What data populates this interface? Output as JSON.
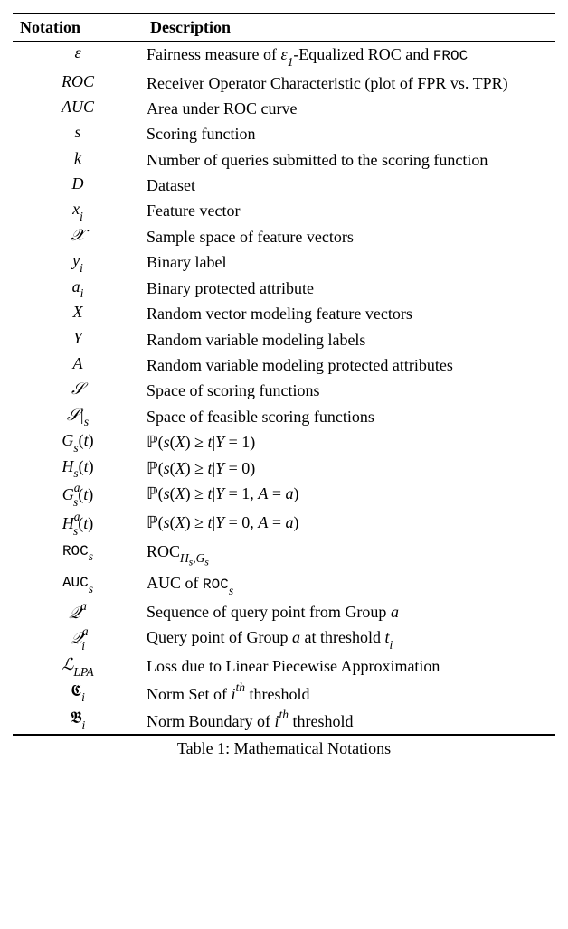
{
  "header": {
    "notation": "Notation",
    "description": "Description"
  },
  "rows": [
    {
      "notation_html": "<span>ε</span>",
      "description_html": "Fairness measure of <i>ε</i><span class='ss'>1</span>-Equalized ROC and <span class='tt'>FROC</span>"
    },
    {
      "notation_html": "<span>ROC</span>",
      "description_html": "Receiver Operator Characteristic (plot of FPR vs. TPR)"
    },
    {
      "notation_html": "<span>AUC</span>",
      "description_html": "Area under ROC curve"
    },
    {
      "notation_html": "<span>s</span>",
      "description_html": "Scoring function"
    },
    {
      "notation_html": "<span>k</span>",
      "description_html": "Number of queries submitted to the scoring function"
    },
    {
      "notation_html": "<span>D</span>",
      "description_html": "Dataset"
    },
    {
      "notation_html": "<span>x<span class='ss'>i</span></span>",
      "description_html": "Feature vector"
    },
    {
      "notation_html": "<span class='cal'>𝒳</span>",
      "description_html": "Sample space of feature vectors"
    },
    {
      "notation_html": "<span>y<span class='ss'>i</span></span>",
      "description_html": "Binary label"
    },
    {
      "notation_html": "<span>a<span class='ss'>i</span></span>",
      "description_html": "Binary protected attribute"
    },
    {
      "notation_html": "<span>X</span>",
      "description_html": "Random vector modeling feature vectors"
    },
    {
      "notation_html": "<span>Y</span>",
      "description_html": "Random variable modeling labels"
    },
    {
      "notation_html": "<span>A</span>",
      "description_html": "Random variable modeling protected attributes"
    },
    {
      "notation_html": "<span class='cal'>𝒮</span>",
      "description_html": "Space of scoring functions"
    },
    {
      "notation_html": "<span class='cal'>𝒮</span>|<span class='ss'>s</span>",
      "description_html": "Space of feasible scoring functions"
    },
    {
      "notation_html": "<span>G<span class='ss'>s</span></span><span class='up'>(</span>t<span class='up'>)</span>",
      "description_html": "<span class='bb'>ℙ</span>(<i>s</i>(<i>X</i>) ≥ <i>t</i>|<i>Y</i> = 1)"
    },
    {
      "notation_html": "<span>H<span class='ss'>s</span></span><span class='up'>(</span>t<span class='up'>)</span>",
      "description_html": "<span class='bb'>ℙ</span>(<i>s</i>(<i>X</i>) ≥ <i>t</i>|<i>Y</i> = 0)"
    },
    {
      "notation_html": "<span>G<span class='sp'>a</span><span class='ss' style='margin-left:-0.55em'>s</span></span><span class='up'>(</span>t<span class='up'>)</span>",
      "description_html": "<span class='bb'>ℙ</span>(<i>s</i>(<i>X</i>) ≥ <i>t</i>|<i>Y</i> = 1, <i>A</i> = <i>a</i>)"
    },
    {
      "notation_html": "<span>H<span class='sp'>a</span><span class='ss' style='margin-left:-0.55em'>s</span></span><span class='up'>(</span>t<span class='up'>)</span>",
      "description_html": "<span class='bb'>ℙ</span>(<i>s</i>(<i>X</i>) ≥ <i>t</i>|<i>Y</i> = 0, <i>A</i> = <i>a</i>)"
    },
    {
      "notation_html": "<span class='tt'>ROC</span><span class='ss'>s</span>",
      "description_html": "ROC<span class='ss'>H<sub style='font-size:0.85em'>s</sub>,G<sub style='font-size:0.85em'>s</sub></span>"
    },
    {
      "notation_html": "<span class='tt'>AUC</span><span class='ss'>s</span>",
      "description_html": "AUC of <span class='tt'>ROC</span><span class='ss'>s</span>"
    },
    {
      "notation_html": "<span class='cal'>𝒬</span><span class='sp'>a</span>",
      "description_html": "Sequence of query point from Group <i>a</i>"
    },
    {
      "notation_html": "<span class='cal'>𝒬</span><span class='sp'>a</span><span class='ss' style='margin-left:-0.55em'>i</span>",
      "description_html": "Query point of Group <i>a</i> at threshold <i>t<span class='ss'>i</span></i>"
    },
    {
      "notation_html": "<span class='cal'>ℒ</span><span class='ss'>LPA</span>",
      "description_html": "Loss due to Linear Piecewise Approximation"
    },
    {
      "notation_html": "<span class='up'>𝕮</span><span class='ss'>i</span>",
      "description_html": "Norm Set of <i>i</i><span class='sp'>th</span> threshold"
    },
    {
      "notation_html": "<span class='up'>𝕭</span><span class='ss'>i</span>",
      "description_html": "Norm Boundary of <i>i</i><span class='sp'>th</span> threshold"
    }
  ],
  "caption": "Table 1: Mathematical Notations"
}
